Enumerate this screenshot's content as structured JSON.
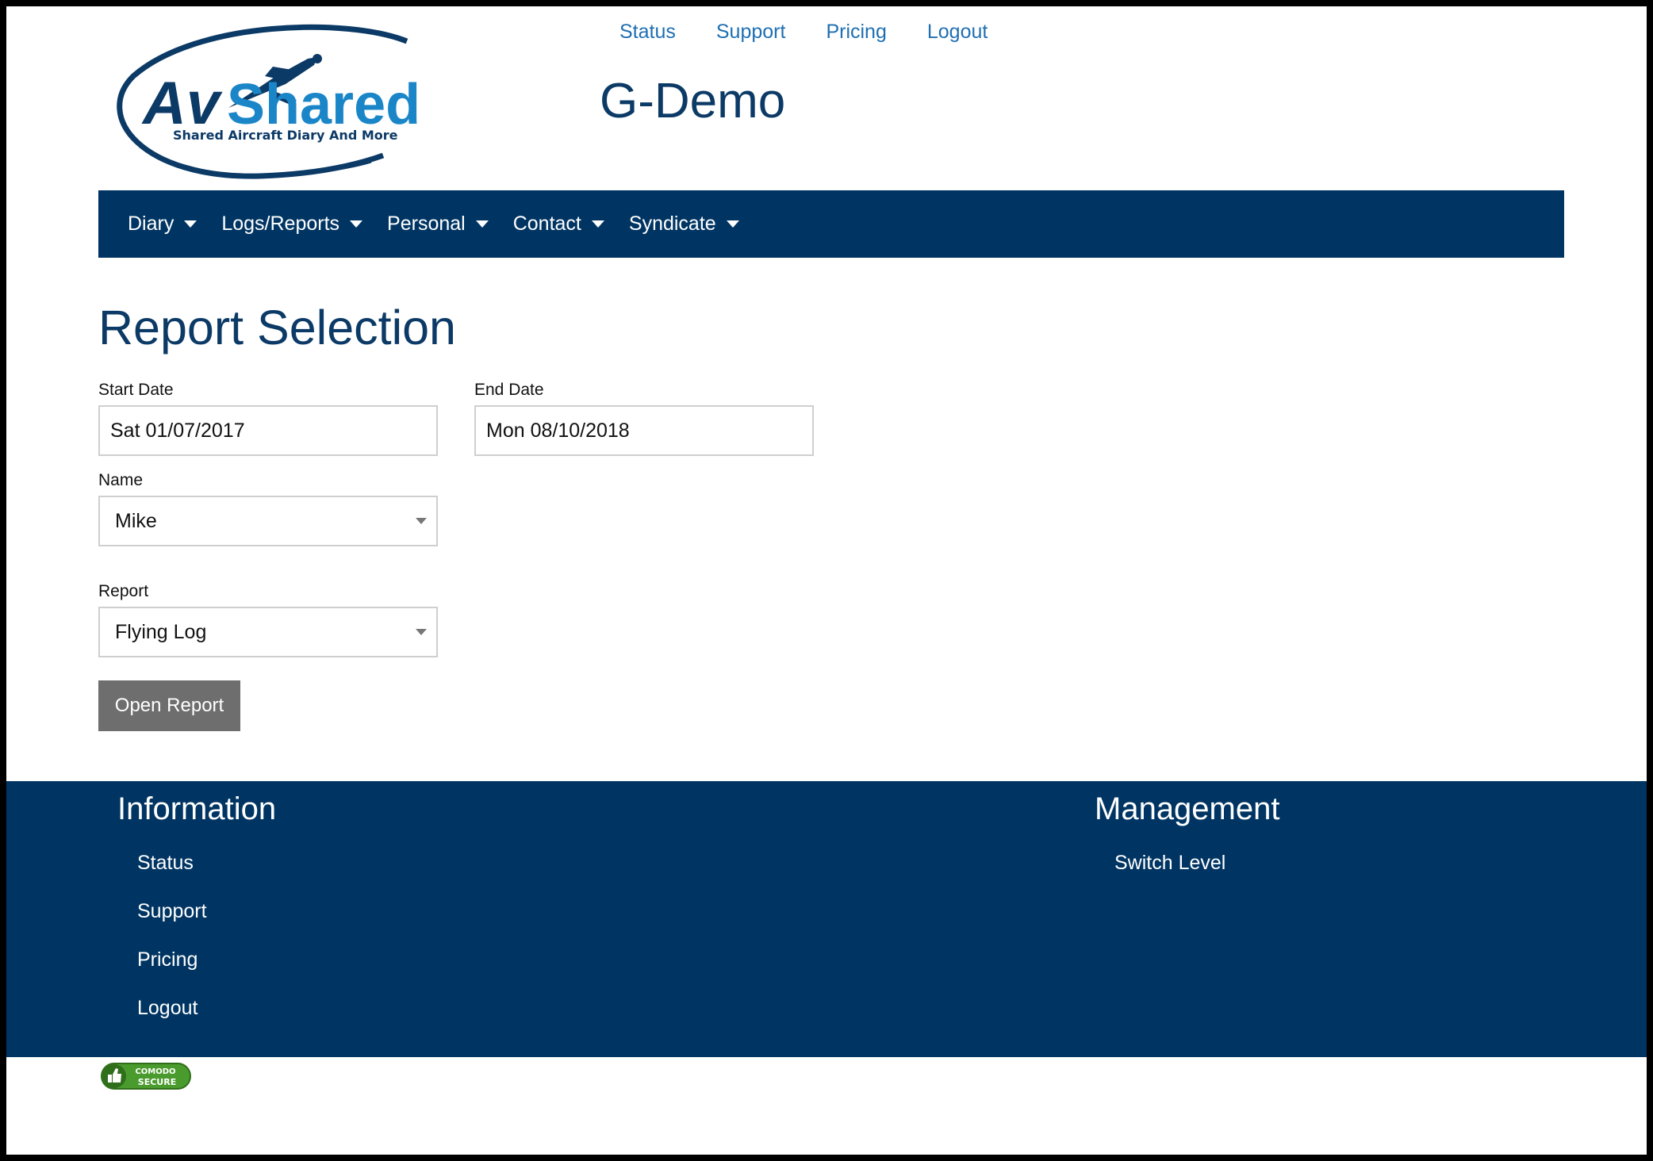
{
  "top_links": [
    "Status",
    "Support",
    "Pricing",
    "Logout"
  ],
  "logo": {
    "name": "AvShared",
    "tagline": "Shared Aircraft Diary And More",
    "colors": {
      "dark": "#0c3a66",
      "light": "#1a86c8"
    }
  },
  "site_title": "G-Demo",
  "nav": {
    "items": [
      {
        "label": "Diary"
      },
      {
        "label": "Logs/Reports"
      },
      {
        "label": "Personal"
      },
      {
        "label": "Contact"
      },
      {
        "label": "Syndicate"
      }
    ]
  },
  "main": {
    "title": "Report Selection",
    "start_date": {
      "label": "Start Date",
      "value": "Sat 01/07/2017"
    },
    "end_date": {
      "label": "End Date",
      "value": "Mon 08/10/2018"
    },
    "name": {
      "label": "Name",
      "value": "Mike"
    },
    "report": {
      "label": "Report",
      "value": "Flying Log"
    },
    "open_button": "Open Report"
  },
  "footer": {
    "information": {
      "heading": "Information",
      "items": [
        "Status",
        "Support",
        "Pricing",
        "Logout"
      ]
    },
    "management": {
      "heading": "Management",
      "items": [
        "Switch Level"
      ]
    }
  },
  "badge": {
    "line1": "COMODO",
    "line2": "SECURE"
  },
  "colors": {
    "nav_bg": "#003563",
    "title": "#0c3a66",
    "link": "#1f6fb2",
    "button": "#6e6e6e"
  }
}
